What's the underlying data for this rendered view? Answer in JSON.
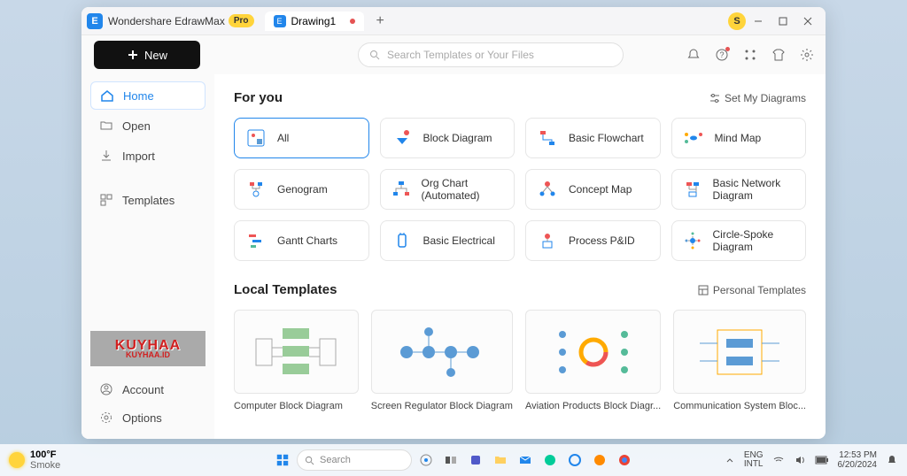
{
  "titlebar": {
    "app_name": "Wondershare EdrawMax",
    "pro": "Pro",
    "tab": "Drawing1",
    "user_initial": "S"
  },
  "topbar": {
    "new": "New",
    "search_placeholder": "Search Templates or Your Files"
  },
  "sidebar": {
    "items": [
      "Home",
      "Open",
      "Import",
      "Templates"
    ],
    "account": "Account",
    "options": "Options",
    "brand1": "KUYHAA",
    "brand2": "KUYHAA.ID"
  },
  "foryou": {
    "title": "For you",
    "link": "Set My Diagrams",
    "cats": [
      "All",
      "Block Diagram",
      "Basic Flowchart",
      "Mind Map",
      "Genogram",
      "Org Chart (Automated)",
      "Concept Map",
      "Basic Network Diagram",
      "Gantt Charts",
      "Basic Electrical",
      "Process P&ID",
      "Circle-Spoke Diagram"
    ]
  },
  "local": {
    "title": "Local Templates",
    "link": "Personal Templates",
    "templates": [
      "Computer Block Diagram",
      "Screen Regulator Block Diagram",
      "Aviation Products Block Diagr...",
      "Communication System Bloc..."
    ]
  },
  "taskbar": {
    "temp": "100°F",
    "cond": "Smoke",
    "search": "Search",
    "lang1": "ENG",
    "lang2": "INTL",
    "time": "12:53 PM",
    "date": "6/20/2024"
  }
}
